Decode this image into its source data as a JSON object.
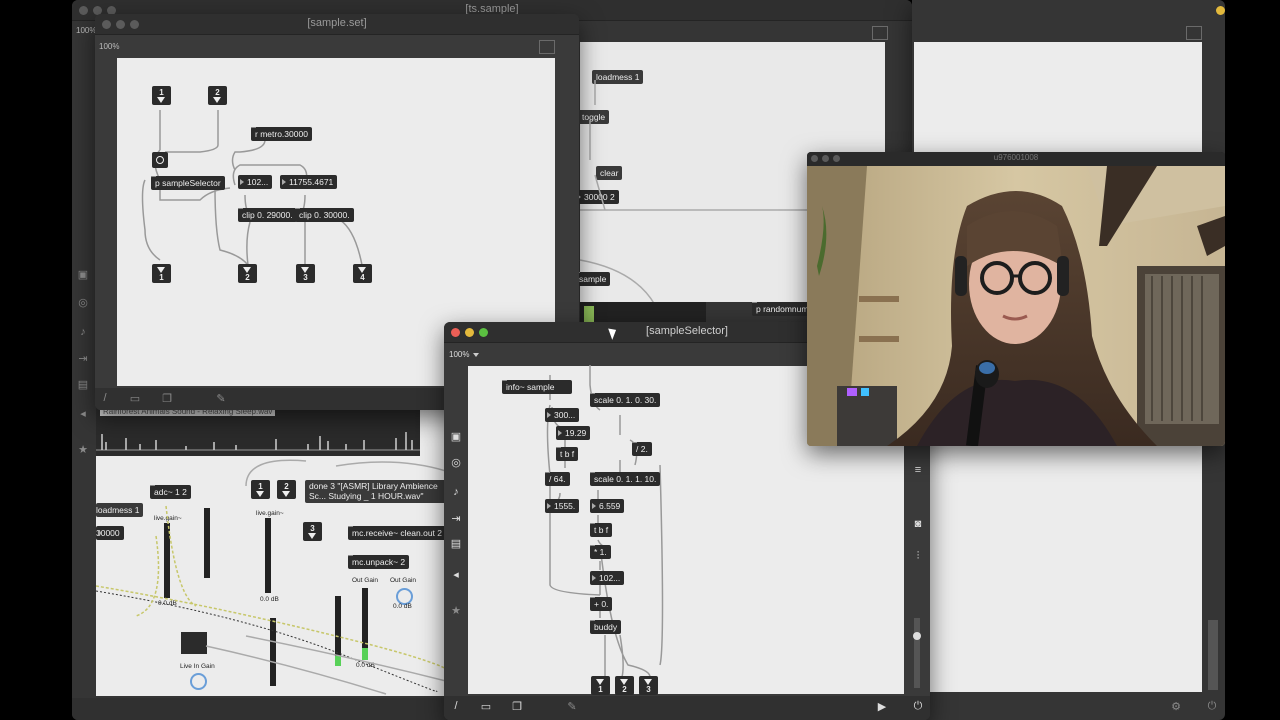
{
  "main_window": {
    "title": "[ts.sample]",
    "zoom": "100%"
  },
  "sample_set": {
    "title": "[sample.set]",
    "zoom": "100%",
    "inlets": [
      "1",
      "2"
    ],
    "outlets": [
      "1",
      "2",
      "3",
      "4"
    ],
    "objects": {
      "r_metro": "r metro.30000",
      "p_sample_selector": "p sampleSelector",
      "num_102": "102...",
      "num_11755": "11755.4671",
      "clip1": "clip 0. 29000.",
      "clip2": "clip 0. 30000."
    }
  },
  "main_patch": {
    "loadmess": "loadmess 1",
    "toggle": "toggle",
    "clear": "clear",
    "num_30000": "30000 2",
    "sample": "sample",
    "p_randomnum": "p randomnum"
  },
  "lower_patch": {
    "waveform_label": "Rainforest Animals Sound - Relaxing Sleep.wav",
    "loadmess": "loadmess 1",
    "num_30000": "30000",
    "adc": "adc~ 1 2",
    "live_gain_1": "live.gain~",
    "live_gain_2": "live.gain~",
    "db_1": "0.0 dB",
    "db_2": "0.0 dB",
    "db_3": "0.0 dB",
    "db_4": "0.0 dB",
    "inlet_1": "1",
    "inlet_2": "2",
    "inlet_3": "3",
    "done_message": "done 3 \"[ASMR] Library Ambience Sc... Studying _ 1 HOUR.wav\"",
    "mc_receive": "mc.receive~ clean.out 2",
    "mc_unpack": "mc.unpack~ 2",
    "out_gain_1": "Out Gain",
    "out_gain_2": "Out Gain",
    "live_in_gain": "Live In Gain"
  },
  "sample_selector": {
    "title": "[sampleSelector]",
    "zoom": "100%",
    "objects": {
      "info_sample": "info~ sample",
      "num_300": "300...",
      "scale1": "scale 0. 1. 0. 30.",
      "num_19_29": "19.29",
      "tbf1": "t b f",
      "div2": "/ 2.",
      "div64": "/ 64.",
      "scale2": "scale 0. 1. 1. 10.",
      "num_1555": "1555.",
      "num_6559": "6.559",
      "tbf2": "t b f",
      "mul1": "* 1.",
      "num_102": "102...",
      "plus0": "+ 0.",
      "buddy": "buddy"
    },
    "outlets": [
      "1",
      "2",
      "3"
    ]
  },
  "webcam": {
    "title": "u976001008"
  },
  "colors": {
    "meter_green": "#58d158",
    "canvas": "#ececec",
    "object_bg": "#2b2b2b"
  }
}
